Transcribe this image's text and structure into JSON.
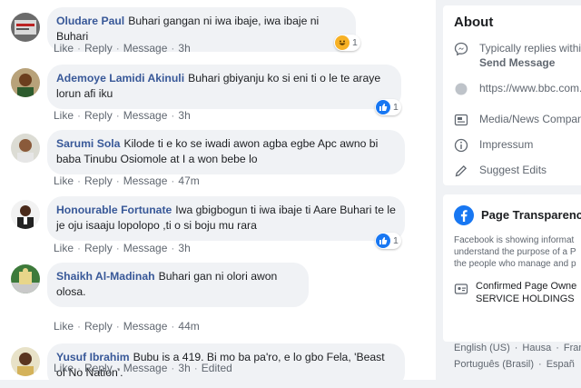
{
  "comments": [
    {
      "author": "Oludare Paul",
      "text": "Buhari gangan ni iwa ibaje, iwa ibaje ni Buhari",
      "actions": [
        "Like",
        "Reply",
        "Message"
      ],
      "time": "3h",
      "reaction": {
        "type": "haha",
        "count": "1"
      }
    },
    {
      "author": "Ademoye Lamidi Akinuli",
      "text": "Buhari gbiyanju ko si eni ti o le te araye lorun afi iku",
      "actions": [
        "Like",
        "Reply",
        "Message"
      ],
      "time": "3h",
      "reaction": {
        "type": "like",
        "count": "1"
      }
    },
    {
      "author": "Sarumi Sola",
      "text": "Kilode ti e ko se iwadi awon agba egbe Apc awno bi baba Tinubu Osiomole at I a won bebe lo",
      "actions": [
        "Like",
        "Reply",
        "Message"
      ],
      "time": "47m"
    },
    {
      "author": "Honourable Fortunate",
      "text": "Iwa gbigbogun ti iwa ibaje ti Aare Buhari te le je oju isaaju lopolopo ,ti o si boju mu rara",
      "actions": [
        "Like",
        "Reply",
        "Message"
      ],
      "time": "3h",
      "reaction": {
        "type": "like",
        "count": "1"
      }
    },
    {
      "author": "Shaikh Al-Madinah",
      "text": "Buhari gan ni olori awon olosa.",
      "actions": [
        "Like",
        "Reply",
        "Message"
      ],
      "time": "44m"
    },
    {
      "author": "Yusuf Ibrahim",
      "text": "Bubu is a 419. Bi mo ba pa'ro, e lo gbo Fela, 'Beast of No Nation'.",
      "actions": [
        "Like",
        "Reply",
        "Message"
      ],
      "time": "3h",
      "edited": "Edited"
    }
  ],
  "about": {
    "title": "About",
    "replies": "Typically replies within",
    "send_message": "Send Message",
    "website": "https://www.bbc.com..",
    "category": "Media/News Company",
    "impressum": "Impressum",
    "suggest": "Suggest Edits"
  },
  "transparency": {
    "title": "Page Transparency",
    "desc_lines": [
      "Facebook is showing informat",
      "understand the purpose of a P",
      "the people who manage and p"
    ],
    "owner_line1": "Confirmed Page Owne",
    "owner_line2": "SERVICE HOLDINGS"
  },
  "languages": {
    "line1": [
      "English (US)",
      "Hausa",
      "Fran"
    ],
    "line2": [
      "Português (Brasil)",
      "Españ"
    ]
  },
  "colors": {
    "link": "#385898",
    "like": "#1877f2",
    "haha": "#f7b125",
    "fb": "#1877f2"
  }
}
